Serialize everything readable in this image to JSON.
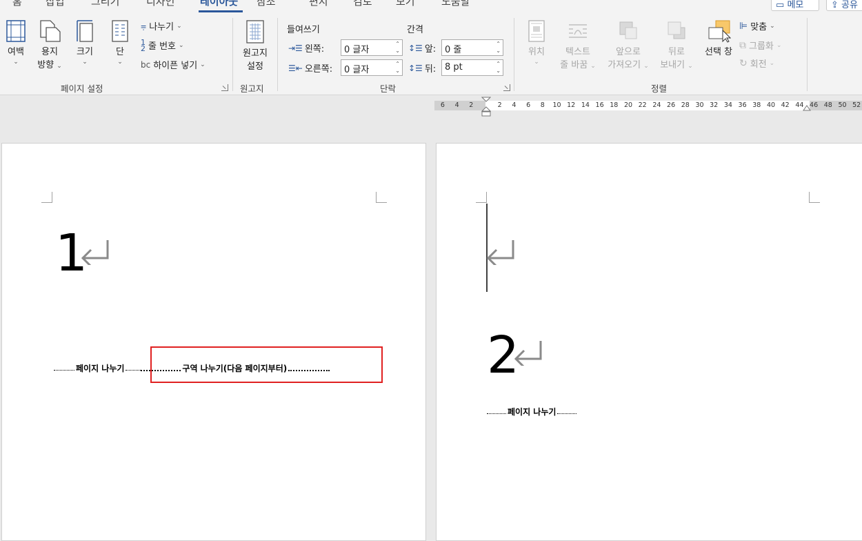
{
  "tabs": [
    {
      "label": "홈"
    },
    {
      "label": "삽입"
    },
    {
      "label": "그리기"
    },
    {
      "label": "디자인"
    },
    {
      "label": "레이아웃",
      "active": true
    },
    {
      "label": "참조"
    },
    {
      "label": "편지"
    },
    {
      "label": "검토"
    },
    {
      "label": "보기"
    },
    {
      "label": "도움말"
    }
  ],
  "top_right": {
    "memo_label": "메모",
    "share_label": "공유"
  },
  "ribbon": {
    "page_setup": {
      "group_label": "페이지 설정",
      "margins": {
        "line1": "여백",
        "line2": ""
      },
      "orientation": {
        "line1": "용지",
        "line2": "방향"
      },
      "size": {
        "line1": "크기",
        "line2": ""
      },
      "columns": {
        "line1": "단",
        "line2": ""
      },
      "breaks": "나누기",
      "line_numbers": "줄 번호",
      "hyphenation": "하이픈 넣기"
    },
    "manuscript": {
      "group_label": "원고지",
      "button": {
        "line1": "원고지",
        "line2": "설정"
      }
    },
    "paragraph": {
      "group_label": "단락",
      "indent_title": "들여쓰기",
      "spacing_title": "간격",
      "left_label": "왼쪽:",
      "left_value": "0 글자",
      "right_label": "오른쪽:",
      "right_value": "0 글자",
      "before_label": "앞:",
      "before_value": "0 줄",
      "after_label": "뒤:",
      "after_value": "8 pt"
    },
    "arrange": {
      "group_label": "정렬",
      "position": {
        "line1": "위치",
        "line2": ""
      },
      "wrap_text": {
        "line1": "텍스트",
        "line2": "줄 바꿈"
      },
      "bring_forward": {
        "line1": "앞으로",
        "line2": "가져오기"
      },
      "send_backward": {
        "line1": "뒤로",
        "line2": "보내기"
      },
      "selection_pane": {
        "line1": "선택 창"
      },
      "align": "맞춤",
      "group": "그룹화",
      "rotate": "회전"
    }
  },
  "ruler": {
    "ticks_left": [
      "6",
      "4",
      "2"
    ],
    "ticks_right": [
      "2",
      "4",
      "6",
      "8",
      "10",
      "12",
      "14",
      "16",
      "18",
      "20",
      "22",
      "24",
      "26",
      "28",
      "30",
      "32",
      "34",
      "36",
      "38",
      "40",
      "42",
      "44",
      "46",
      "48",
      "50",
      "52"
    ]
  },
  "document": {
    "page1": {
      "number_text": "1",
      "page_break_label": "페이지 나누기",
      "section_break_label": "구역 나누기(다음 페이지부터)"
    },
    "page2": {
      "number_text": "2",
      "page_break_label": "페이지 나누기"
    }
  },
  "colors": {
    "accent": "#2b579a",
    "highlight": "#e02020"
  }
}
